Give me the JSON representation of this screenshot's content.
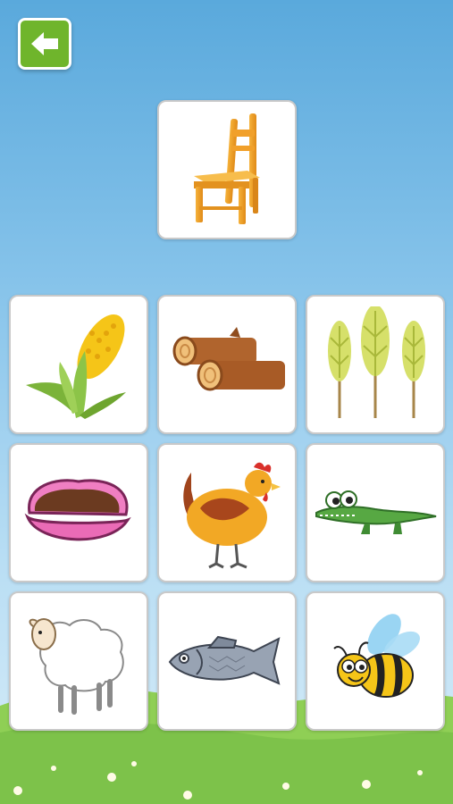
{
  "screen": {
    "back_button_icon": "back-arrow-icon",
    "target": {
      "icon": "chair-icon"
    },
    "options": [
      {
        "icon": "corn-icon"
      },
      {
        "icon": "logs-icon"
      },
      {
        "icon": "wheat-icon"
      },
      {
        "icon": "clam-shell-icon"
      },
      {
        "icon": "hen-icon"
      },
      {
        "icon": "crocodile-icon"
      },
      {
        "icon": "sheep-icon"
      },
      {
        "icon": "fish-icon"
      },
      {
        "icon": "bee-icon"
      }
    ]
  },
  "colors": {
    "sky_top": "#5aa9dc",
    "grass": "#7dc24a",
    "back_button": "#6fb52c",
    "card_border": "#c9c9c9"
  }
}
